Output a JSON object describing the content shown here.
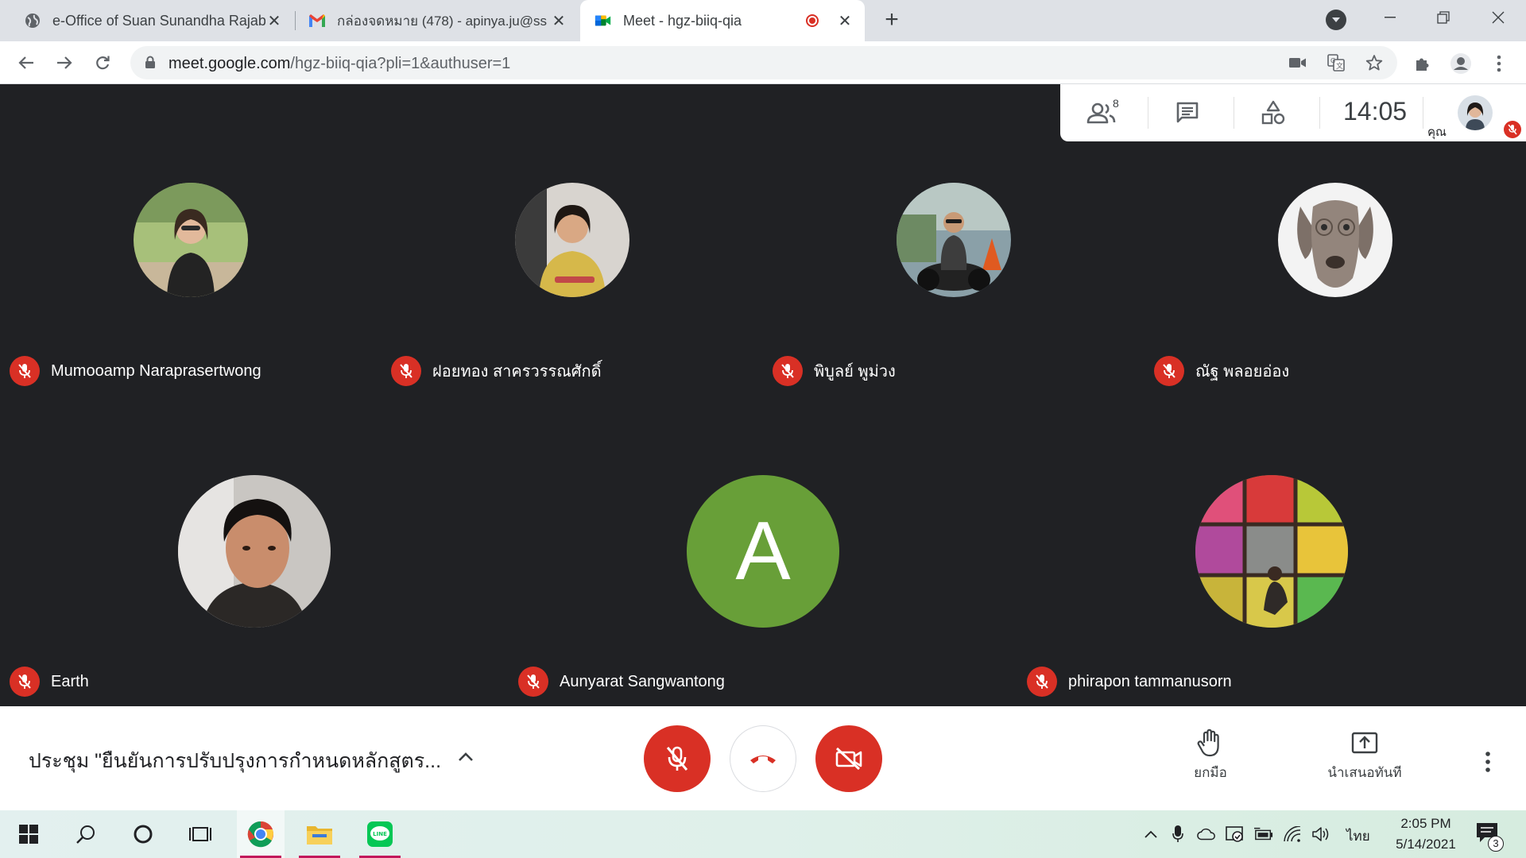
{
  "browser": {
    "tabs": [
      {
        "title": "e-Office of Suan Sunandha Rajab",
        "favicon": "globe-icon"
      },
      {
        "title": "กล่องจดหมาย (478) - apinya.ju@ss",
        "favicon": "gmail-icon"
      },
      {
        "title": "Meet - hgz-biiq-qia",
        "favicon": "meet-icon",
        "active": true,
        "recording": true
      }
    ],
    "url_host": "meet.google.com",
    "url_path": "/hgz-biiq-qia?pli=1&authuser=1"
  },
  "meet": {
    "participant_count": "8",
    "time": "14:05",
    "self_label": "คุณ",
    "participants": [
      {
        "name": "Mumooamp Naraprasertwong",
        "muted": true
      },
      {
        "name": "ฝอยทอง สาครวรรณศักดิ์",
        "muted": true
      },
      {
        "name": "พิบูลย์ พูม่วง",
        "muted": true
      },
      {
        "name": "ณัฐ พลอยอ่อง",
        "muted": true
      },
      {
        "name": "Earth",
        "muted": true
      },
      {
        "name": "Aunyarat Sangwantong",
        "muted": true,
        "initial": "A",
        "avatar_color": "#689f38"
      },
      {
        "name": "phirapon tammanusorn",
        "muted": true
      }
    ],
    "meeting_title": "ประชุม \"ยืนยันการปรับปรุงการกำหนดหลักสูตร...",
    "raise_hand_label": "ยกมือ",
    "present_label": "นำเสนอทันที",
    "colors": {
      "danger": "#d93025",
      "stage": "#202124"
    }
  },
  "taskbar": {
    "language": "ไทย",
    "time": "2:05 PM",
    "date": "5/14/2021",
    "notification_count": "3"
  }
}
